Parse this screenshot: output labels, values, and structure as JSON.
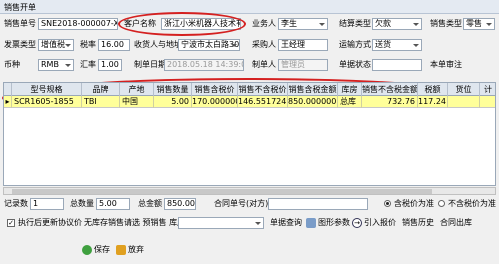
{
  "window": {
    "title": "销售开单"
  },
  "form": {
    "order_no": {
      "label": "销售单号",
      "value": "SNE2018-000007-XXX"
    },
    "customer": {
      "label": "客户名称",
      "value": "浙江小米机器人技术有限"
    },
    "salesman": {
      "label": "业务人",
      "value": "李生"
    },
    "settle_type": {
      "label": "结算类型",
      "value": "欠款"
    },
    "sales_type": {
      "label": "销售类型",
      "value": "零售"
    },
    "invoice_type": {
      "label": "发票类型",
      "value": "增值税"
    },
    "tax_rate": {
      "label": "税率",
      "value": "16.00"
    },
    "receiver_addr": {
      "label": "收货人与地址",
      "value": "宁波市太白路30号"
    },
    "buyer": {
      "label": "采购人",
      "value": "王经理"
    },
    "ship_method": {
      "label": "运输方式",
      "value": "送货"
    },
    "currency": {
      "label": "币种",
      "value": "RMB"
    },
    "exchange_rate": {
      "label": "汇率",
      "value": "1.00"
    },
    "create_time": {
      "label": "制单日期",
      "value": "2018.05.18 14:39:0"
    },
    "creator": {
      "label": "制单人",
      "value": "管理员"
    },
    "status": {
      "label": "单据状态",
      "value": ""
    },
    "current_no": {
      "label": "本单审注",
      "value": ""
    }
  },
  "grid": {
    "columns": [
      "型号规格",
      "品牌",
      "产地",
      "销售数量",
      "销售含税价",
      "销售不含税价",
      "销售含税金额",
      "库房",
      "销售不含税金额",
      "税额",
      "货位",
      "计"
    ],
    "rows": [
      [
        "SCR1605-1855",
        "TBI",
        "中国",
        "5.00",
        "170.000000",
        "146.551724",
        "850.000000",
        "总库",
        "732.76",
        "117.24",
        "",
        ""
      ]
    ]
  },
  "footer": {
    "record_count": {
      "label": "记录数",
      "value": "1"
    },
    "total_qty": {
      "label": "总数量",
      "value": "5.00"
    },
    "total_amount": {
      "label": "总金额",
      "value": "850.00"
    },
    "contract_no": {
      "label": "合同单号(对方)",
      "value": ""
    },
    "tax_included": "含税价为准",
    "tax_excluded": "不含税价为准",
    "after_audit": "执行后更新协议价",
    "no_stock_hint": "无库存销售请选 预销售 库房",
    "query": "单据查询",
    "chart_params": "图形参数",
    "import_quote": "引入报价",
    "sales_history": "销售历史",
    "contract_out": "合同出库",
    "save": "保存",
    "abandon": "放弃"
  }
}
